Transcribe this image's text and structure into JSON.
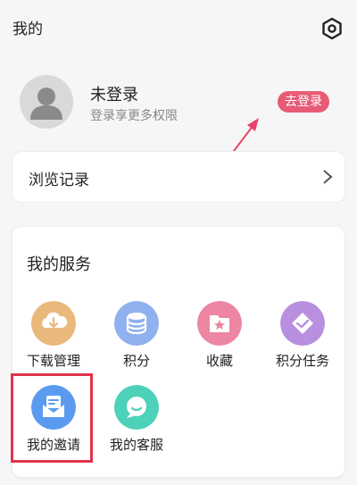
{
  "header": {
    "title": "我的"
  },
  "profile": {
    "name": "未登录",
    "subtitle": "登录享更多权限",
    "login_button": "去登录"
  },
  "history": {
    "label": "浏览记录"
  },
  "services": {
    "title": "我的服务",
    "items": [
      {
        "label": "下载管理",
        "icon": "download-cloud-icon",
        "color": "#e9b97c"
      },
      {
        "label": "积分",
        "icon": "coins-stack-icon",
        "color": "#8fb1ef"
      },
      {
        "label": "收藏",
        "icon": "star-folder-icon",
        "color": "#ec86a2"
      },
      {
        "label": "积分任务",
        "icon": "diamond-tag-icon",
        "color": "#b98fdf"
      },
      {
        "label": "我的邀请",
        "icon": "invitation-envelope-icon",
        "color": "#5a9bf0"
      },
      {
        "label": "我的客服",
        "icon": "chat-bubble-icon",
        "color": "#4dd1b8"
      }
    ]
  },
  "colors": {
    "accent": "#e85b76",
    "highlight": "#e0344c",
    "background": "#f6f6f6"
  }
}
